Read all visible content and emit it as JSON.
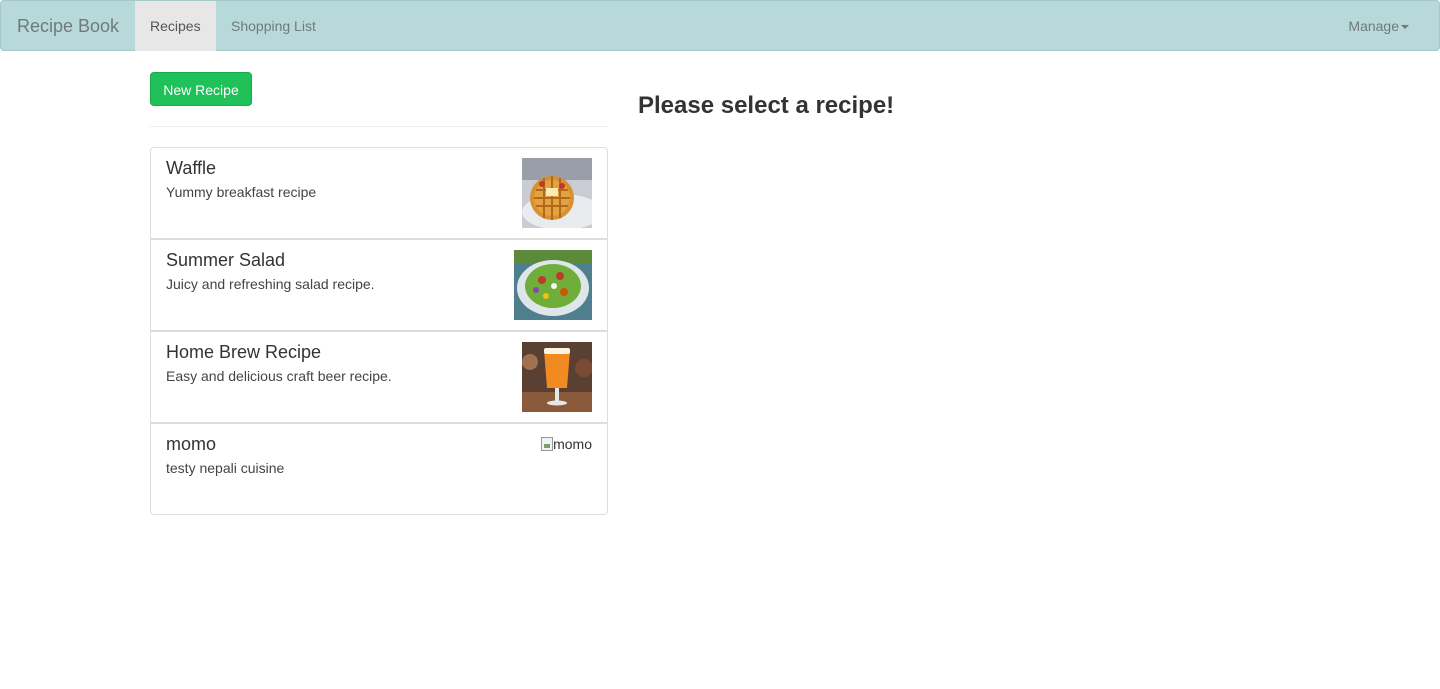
{
  "navbar": {
    "brand": "Recipe Book",
    "tabs": [
      {
        "label": "Recipes",
        "active": true
      },
      {
        "label": "Shopping List",
        "active": false
      }
    ],
    "manage_label": "Manage"
  },
  "colors": {
    "navbar_bg": "#b8d9d9",
    "active_tab_bg": "#e7e7e7",
    "success_button": "#1fc158"
  },
  "sidebar": {
    "new_button_label": "New Recipe",
    "recipes": [
      {
        "name": "Waffle",
        "description": "Yummy breakfast recipe",
        "image": "waffle-photo"
      },
      {
        "name": "Summer Salad",
        "description": "Juicy and refreshing salad recipe.",
        "image": "salad-photo"
      },
      {
        "name": "Home Brew Recipe",
        "description": "Easy and delicious craft beer recipe.",
        "image": "beer-photo"
      },
      {
        "name": "momo",
        "description": "testy nepali cuisine",
        "image_alt": "momo"
      }
    ]
  },
  "main": {
    "placeholder_title": "Please select a recipe!"
  }
}
